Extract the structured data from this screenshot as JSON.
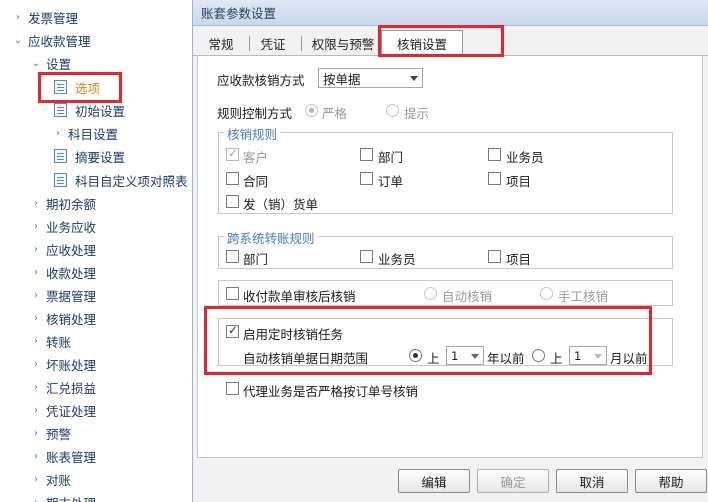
{
  "nav": {
    "items": [
      {
        "label": "发票管理",
        "arrow": "›"
      },
      {
        "label": "应收款管理",
        "arrow": "⌄"
      },
      {
        "label": "设置",
        "arrow": "⌄"
      },
      {
        "label": "选项"
      },
      {
        "label": "初始设置"
      },
      {
        "label": "科目设置",
        "arrow": "›"
      },
      {
        "label": "摘要设置"
      },
      {
        "label": "科目自定义项对照表"
      },
      {
        "label": "期初余额",
        "arrow": "›"
      },
      {
        "label": "业务应收",
        "arrow": "›"
      },
      {
        "label": "应收处理",
        "arrow": "›"
      },
      {
        "label": "收款处理",
        "arrow": "›"
      },
      {
        "label": "票据管理",
        "arrow": "›"
      },
      {
        "label": "核销处理",
        "arrow": "›"
      },
      {
        "label": "转账",
        "arrow": "›"
      },
      {
        "label": "坏账处理",
        "arrow": "›"
      },
      {
        "label": "汇兑损益",
        "arrow": "›"
      },
      {
        "label": "凭证处理",
        "arrow": "›"
      },
      {
        "label": "预警",
        "arrow": "›"
      },
      {
        "label": "账表管理",
        "arrow": "›"
      },
      {
        "label": "对账",
        "arrow": "›"
      },
      {
        "label": "期末处理",
        "arrow": "›"
      }
    ]
  },
  "dialog": {
    "title": "账套参数设置",
    "tabs": [
      "常规",
      "凭证",
      "权限与预警",
      "核销设置"
    ],
    "settle_method_label": "应收款核销方式",
    "settle_method_value": "按单据",
    "rule_control_label": "规则控制方式",
    "rule_strict": "严格",
    "rule_hint": "提示",
    "settle_rules_title": "核销规则",
    "settle_rules": {
      "customer": "客户",
      "department": "部门",
      "salesman": "业务员",
      "contract": "合同",
      "order": "订单",
      "project": "项目",
      "invoice": "发（销）货单"
    },
    "cross_rules_title": "跨系统转账规则",
    "cross_rules": {
      "department": "部门",
      "salesman": "业务员",
      "project": "项目"
    },
    "receipt_audit_label": "收付款单审核后核销",
    "auto_settle": "自动核销",
    "manual_settle": "手工核销",
    "timed_task_label": "启用定时核销任务",
    "date_range_label": "自动核销单据日期范围",
    "range_option_a_prefix": "上",
    "range_option_a_value": "1",
    "range_option_a_suffix": "年以前",
    "range_option_b_prefix": "上",
    "range_option_b_value": "1",
    "range_option_b_suffix": "月以前",
    "agency_label": "代理业务是否严格按订单号核销",
    "buttons": {
      "edit": "编辑",
      "ok": "确定",
      "cancel": "取消",
      "help": "帮助"
    }
  },
  "colors": {
    "highlight_box": "#e8242c",
    "selected_nav_text": "#e0821b",
    "group_title": "#4a7cc4",
    "nav_text": "#1d3b6b"
  }
}
